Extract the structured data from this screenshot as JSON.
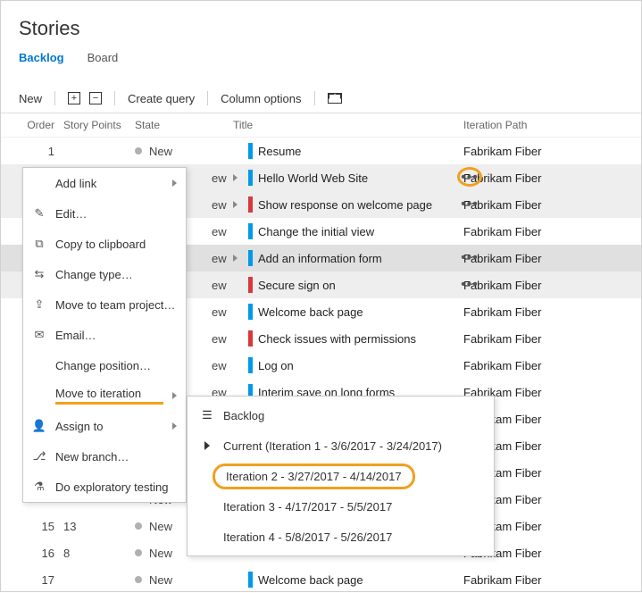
{
  "title": "Stories",
  "tabs": {
    "backlog": "Backlog",
    "board": "Board"
  },
  "toolbar": {
    "new": "New",
    "create_query": "Create query",
    "column_options": "Column options"
  },
  "columns": {
    "order": "Order",
    "sp": "Story Points",
    "state": "State",
    "title": "Title",
    "iter": "Iteration Path"
  },
  "state_new": "New",
  "iter_path": "Fabrikam Fiber",
  "rows": [
    {
      "order": "1",
      "sp": "",
      "title": "Resume",
      "bar": "blue",
      "expand": false,
      "sel": false,
      "ellipsis": false
    },
    {
      "order": "",
      "sp": "",
      "title": "Hello World Web Site",
      "bar": "blue",
      "expand": true,
      "sel": true,
      "ellipsis": true,
      "circled": true
    },
    {
      "order": "",
      "sp": "",
      "title": "Show response on welcome page",
      "bar": "red",
      "expand": true,
      "sel": true,
      "ellipsis": true
    },
    {
      "order": "",
      "sp": "",
      "title": "Change the initial view",
      "bar": "blue",
      "expand": false,
      "sel": false,
      "ellipsis": false
    },
    {
      "order": "",
      "sp": "",
      "title": "Add an information form",
      "bar": "blue",
      "expand": true,
      "sel": true,
      "strong": true,
      "ellipsis": true
    },
    {
      "order": "",
      "sp": "",
      "title": "Secure sign on",
      "bar": "red",
      "expand": false,
      "sel": true,
      "ellipsis": true
    },
    {
      "order": "",
      "sp": "",
      "title": "Welcome back page",
      "bar": "blue",
      "expand": false,
      "sel": false,
      "ellipsis": false
    },
    {
      "order": "",
      "sp": "",
      "title": "Check issues with permissions",
      "bar": "red",
      "expand": false,
      "sel": false,
      "ellipsis": false
    },
    {
      "order": "",
      "sp": "",
      "title": "Log on",
      "bar": "blue",
      "expand": false,
      "sel": false,
      "ellipsis": false
    },
    {
      "order": "",
      "sp": "",
      "title": "Interim save on long forms",
      "bar": "blue",
      "expand": false,
      "sel": false,
      "ellipsis": false
    },
    {
      "order": "",
      "sp": "",
      "title": "",
      "bar": "",
      "expand": false,
      "sel": false,
      "ellipsis": false
    },
    {
      "order": "",
      "sp": "",
      "title": "",
      "bar": "",
      "expand": false,
      "sel": false,
      "ellipsis": false
    },
    {
      "order": "",
      "sp": "",
      "title": "",
      "bar": "",
      "expand": false,
      "sel": false,
      "ellipsis": false
    },
    {
      "order": "",
      "sp": "",
      "title": "",
      "bar": "",
      "expand": false,
      "sel": false,
      "ellipsis": false
    },
    {
      "order": "15",
      "sp": "13",
      "title": "",
      "bar": "",
      "expand": false,
      "sel": false,
      "ellipsis": false
    },
    {
      "order": "16",
      "sp": "8",
      "title": "",
      "bar": "",
      "expand": false,
      "sel": false,
      "ellipsis": false
    },
    {
      "order": "17",
      "sp": "",
      "title": "Welcome back page",
      "bar": "blue",
      "expand": false,
      "sel": false,
      "ellipsis": false
    }
  ],
  "ctx": {
    "add_link": "Add link",
    "edit": "Edit…",
    "copy": "Copy to clipboard",
    "change_type": "Change type…",
    "move_team": "Move to team project…",
    "email": "Email…",
    "change_pos": "Change position…",
    "move_iter": "Move to iteration",
    "assign": "Assign to",
    "branch": "New branch…",
    "explore": "Do exploratory testing"
  },
  "sub": {
    "backlog": "Backlog",
    "current": "Current (Iteration 1 - 3/6/2017 - 3/24/2017)",
    "iter2": "Iteration 2 - 3/27/2017 - 4/14/2017",
    "iter3": "Iteration 3 - 4/17/2017 - 5/5/2017",
    "iter4": "Iteration 4 - 5/8/2017 - 5/26/2017"
  },
  "partial_state": "ew"
}
